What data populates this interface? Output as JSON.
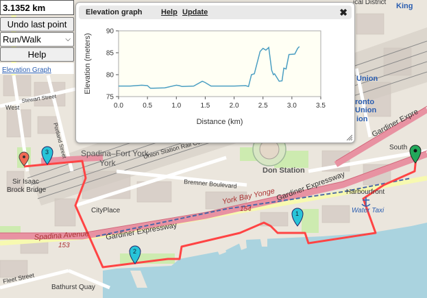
{
  "controls": {
    "distance": "3.1352 km",
    "undo_label": "Undo last point",
    "mode_value": "Run/Walk",
    "help_label": "Help",
    "elevation_link": "Elevation Graph"
  },
  "graph_window": {
    "title": "Elevation graph",
    "help_link": "Help",
    "update_link": "Update"
  },
  "chart_data": {
    "type": "line",
    "xlabel": "Distance (km)",
    "ylabel": "Elevation (meters)",
    "xlim": [
      0,
      3.5
    ],
    "ylim": [
      75,
      90
    ],
    "xticks": [
      "0.0",
      "0.5",
      "1.0",
      "1.5",
      "2.0",
      "2.5",
      "3.0",
      "3.5"
    ],
    "yticks": [
      "75",
      "80",
      "85",
      "90"
    ],
    "grid": false,
    "color": "#4a9ec2",
    "x": [
      0.0,
      0.2,
      0.4,
      0.5,
      0.55,
      0.6,
      0.8,
      1.0,
      1.05,
      1.1,
      1.3,
      1.45,
      1.5,
      1.6,
      1.8,
      2.0,
      2.2,
      2.25,
      2.3,
      2.35,
      2.45,
      2.5,
      2.55,
      2.6,
      2.65,
      2.68,
      2.7,
      2.78,
      2.83,
      2.86,
      2.9,
      2.95,
      3.05,
      3.1,
      3.13
    ],
    "y": [
      77.4,
      77.4,
      77.6,
      77.5,
      76.9,
      76.9,
      77.0,
      77.6,
      77.5,
      77.3,
      77.4,
      78.5,
      78.2,
      77.4,
      77.4,
      77.4,
      77.5,
      77.3,
      80.0,
      80.2,
      85.3,
      86.0,
      85.6,
      86.2,
      81.0,
      80.0,
      80.2,
      78.5,
      78.6,
      81.5,
      81.3,
      84.6,
      84.7,
      86.0,
      86.4
    ]
  },
  "map": {
    "labels": {
      "spadina_fort_york": "Spadina–Fort York",
      "don_station": "Don Station",
      "union_station_rail": "Union Station Rail Corridor",
      "gardiner_1": "Gardiner Expressway",
      "gardiner_2": "Gardiner Expressway",
      "gardiner_3": "Gardiner Expressway",
      "gardiner_4": "Gardiner Expre",
      "york_bay": "York Bay Yonge",
      "route_154": "154",
      "bremner": "Bremner Boulevard",
      "harbourfront": "Harbourfront",
      "water_taxi": "Water Taxi",
      "cityplace": "CityPlace",
      "spadina_ave": "Spadina Avenue",
      "route_153": "153",
      "bathurst_quay": "Bathurst Quay",
      "fleet_street": "Fleet Street",
      "stewart_street": "Stewart Street",
      "portland_street": "Portland Street",
      "west": "West",
      "sir_isaac": "Sir Isaac",
      "brock_bridge": "Brock Bridge",
      "south": "South",
      "king": "King",
      "district": "ical District",
      "union": "Union",
      "toronto": "ronto",
      "union2": "Union",
      "ion": "ion"
    },
    "markers": [
      "1",
      "2",
      "3"
    ]
  }
}
